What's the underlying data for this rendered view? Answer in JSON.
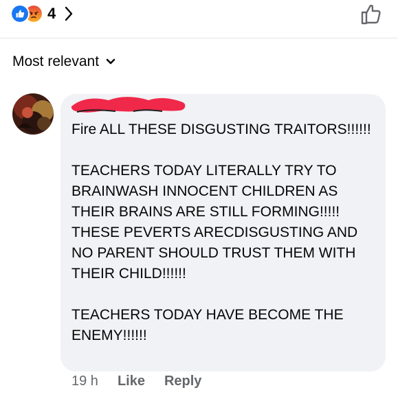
{
  "reactions": {
    "count": "4",
    "icons": [
      "like-icon",
      "angry-icon"
    ],
    "like_color": "#1877f2",
    "angry_color": "#f7714c"
  },
  "sort": {
    "label": "Most relevant"
  },
  "comment": {
    "author": "",
    "text": "Fire ALL THESE DISGUSTING TRAITORS!!!!!!\n\nTEACHERS TODAY LITERALLY TRY TO BRAINWASH INNOCENT CHILDREN AS THEIR BRAINS ARE STILL FORMING!!!!! THESE PEVERTS ARECDISGUSTING AND NO PARENT SHOULD TRUST THEM WITH THEIR CHILD!!!!!!\n\nTEACHERS TODAY HAVE BECOME THE ENEMY!!!!!!",
    "timestamp": "19 h",
    "like_label": "Like",
    "reply_label": "Reply",
    "redaction_color": "#f02849"
  }
}
